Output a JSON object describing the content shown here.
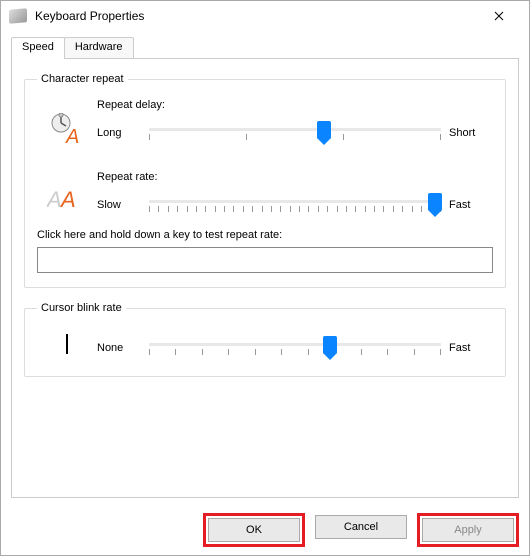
{
  "title": "Keyboard Properties",
  "tabs": {
    "speed": "Speed",
    "hardware": "Hardware"
  },
  "group1": {
    "legend": "Character repeat",
    "repeat_delay_label": "Repeat delay:",
    "delay_left": "Long",
    "delay_right": "Short",
    "delay_value": 60,
    "repeat_rate_label": "Repeat rate:",
    "rate_left": "Slow",
    "rate_right": "Fast",
    "rate_value": 98,
    "test_label": "Click here and hold down a key to test repeat rate:",
    "test_value": ""
  },
  "group2": {
    "legend": "Cursor blink rate",
    "left": "None",
    "right": "Fast",
    "value": 62
  },
  "buttons": {
    "ok": "OK",
    "cancel": "Cancel",
    "apply": "Apply"
  }
}
